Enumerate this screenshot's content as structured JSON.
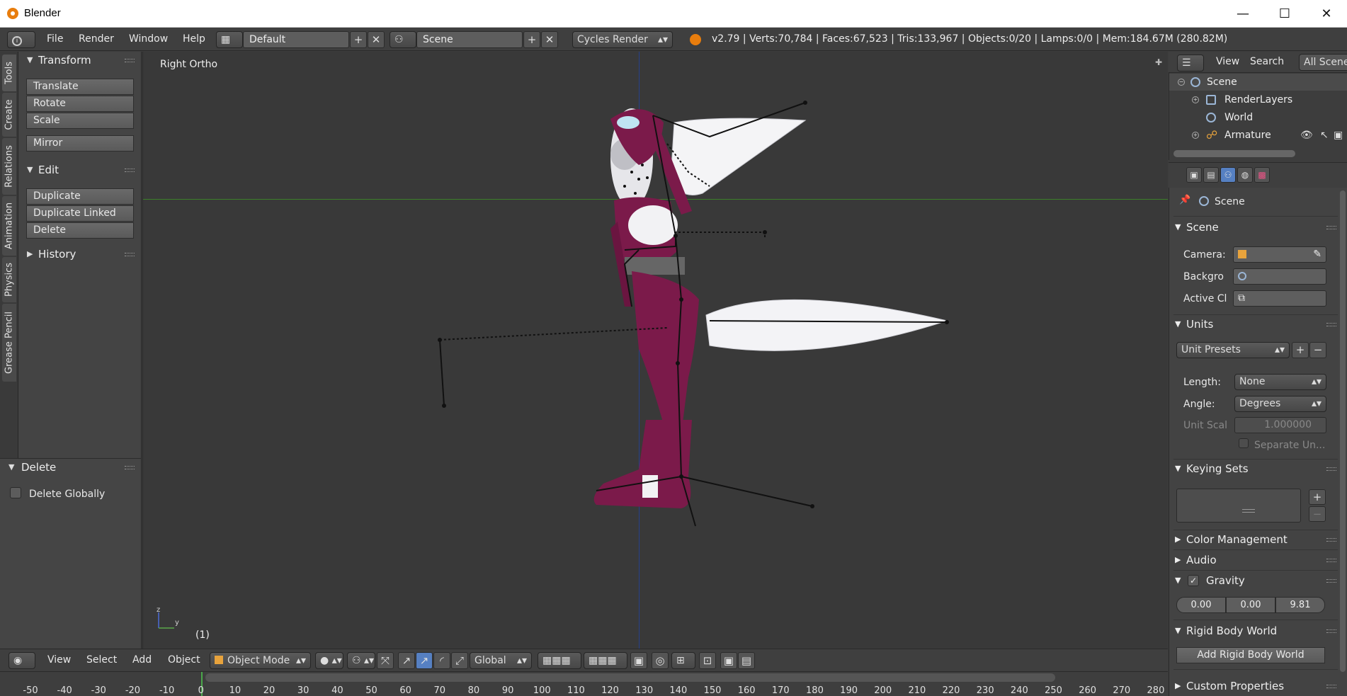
{
  "window": {
    "title": "Blender",
    "minimize": "—",
    "maximize": "☐",
    "close": "✕"
  },
  "info": {
    "menus": [
      "File",
      "Render",
      "Window",
      "Help"
    ],
    "layout": "Default",
    "scene": "Scene",
    "engine": "Cycles Render",
    "stats": "v2.79 | Verts:70,784 | Faces:67,523 | Tris:133,967 | Objects:0/20 | Lamps:0/0 | Mem:184.67M (280.82M)"
  },
  "tabs": [
    "Tools",
    "Create",
    "Relations",
    "Animation",
    "Physics",
    "Grease Pencil"
  ],
  "toolshelf": {
    "transform_title": "Transform",
    "transform_buttons": [
      "Translate",
      "Rotate",
      "Scale"
    ],
    "mirror": "Mirror",
    "edit_title": "Edit",
    "edit_buttons": [
      "Duplicate",
      "Duplicate Linked",
      "Delete"
    ],
    "history_title": "History"
  },
  "operator": {
    "title": "Delete",
    "checkbox_label": "Delete Globally"
  },
  "viewport": {
    "label": "Right Ortho",
    "frame": "(1)",
    "axis_z": "z",
    "axis_y": "y"
  },
  "vp_header": {
    "menus": [
      "View",
      "Select",
      "Add",
      "Object"
    ],
    "mode": "Object Mode",
    "orientation": "Global"
  },
  "timeline": {
    "ticks": [
      "-50",
      "-40",
      "-30",
      "-20",
      "-10",
      "0",
      "10",
      "20",
      "30",
      "40",
      "50",
      "60",
      "70",
      "80",
      "90",
      "100",
      "110",
      "120",
      "130",
      "140",
      "150",
      "160",
      "170",
      "180",
      "190",
      "200",
      "210",
      "220",
      "230",
      "240",
      "250",
      "260",
      "270",
      "280"
    ]
  },
  "outliner": {
    "menus": [
      "View",
      "Search",
      "All Scenes"
    ],
    "rows": [
      "Scene",
      "RenderLayers",
      "World",
      "Armature"
    ]
  },
  "properties": {
    "context": "Scene",
    "scene_panel": "Scene",
    "camera_label": "Camera:",
    "background_label": "Backgro",
    "active_clip_label": "Active Cl",
    "units_panel": "Units",
    "unit_presets": "Unit Presets",
    "length_label": "Length:",
    "length_value": "None",
    "angle_label": "Angle:",
    "angle_value": "Degrees",
    "unit_scale_label": "Unit Scal",
    "unit_scale_value": "1.000000",
    "separate_units": "Separate Un...",
    "keying_sets": "Keying Sets",
    "color_management": "Color Management",
    "audio": "Audio",
    "gravity": "Gravity",
    "gravity_values": [
      "0.00",
      "0.00",
      "9.81"
    ],
    "rigid_body_world": "Rigid Body World",
    "add_rigid_body_world": "Add Rigid Body World",
    "custom_properties": "Custom Properties"
  },
  "colors": {
    "accent": "#5680c2",
    "character": "#7b1a4a",
    "wing": "#ffffff",
    "y_axis": "#3c7f2a",
    "z_axis": "#26418a"
  }
}
